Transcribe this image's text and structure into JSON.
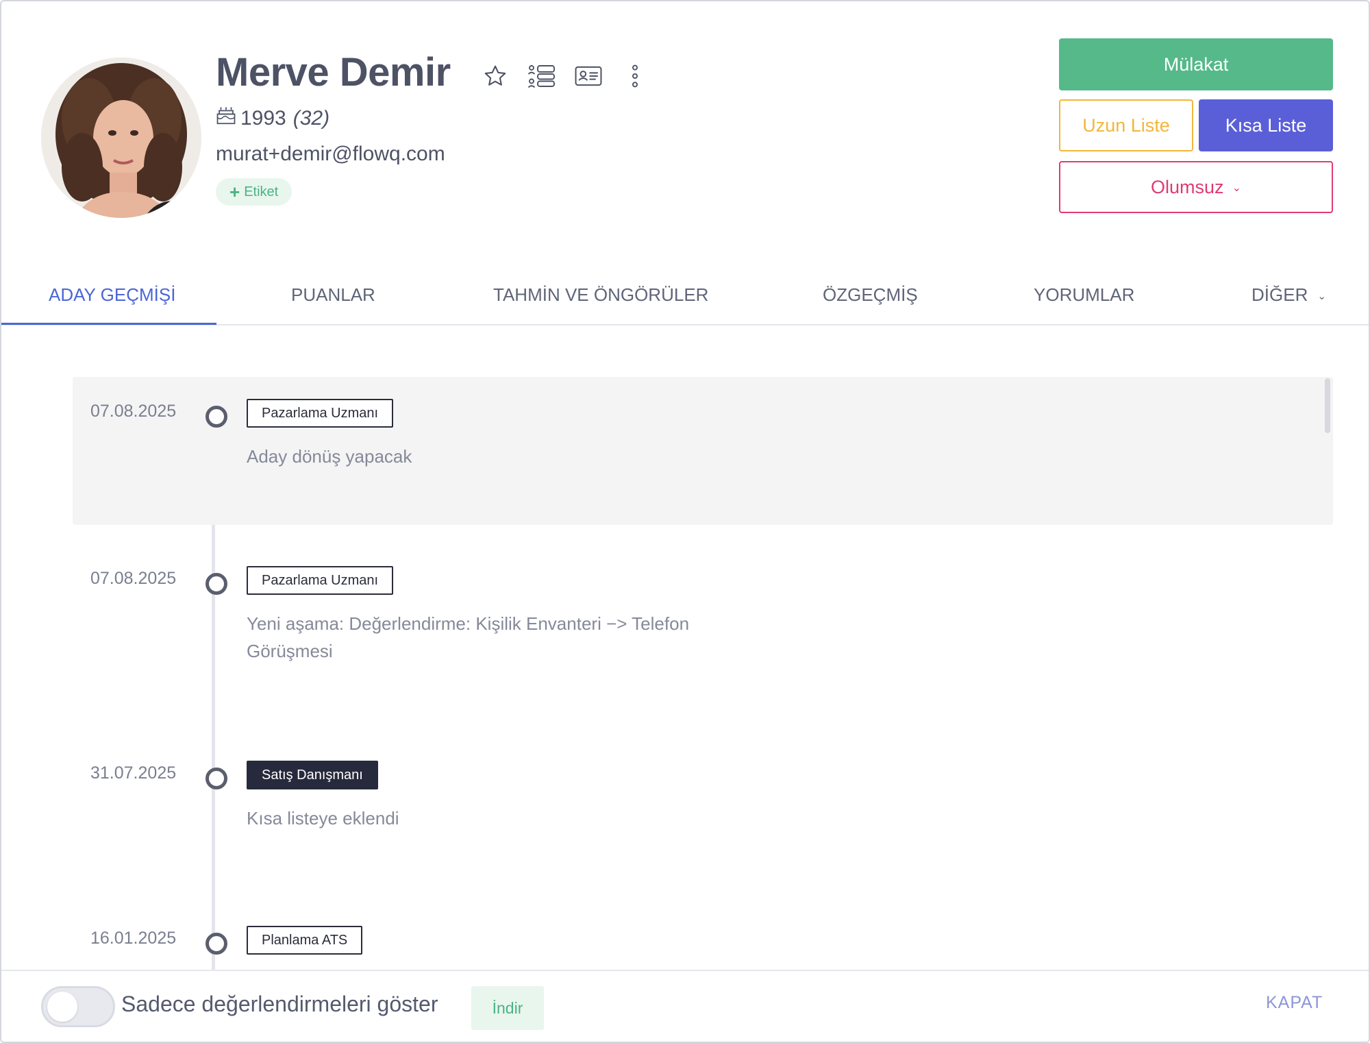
{
  "candidate": {
    "name": "Merve Demir",
    "birth_year": "1993",
    "age": "(32)",
    "email": "murat+demir@flowq.com",
    "tag_button": "Etiket"
  },
  "header_icons": [
    "star-icon",
    "pipeline-icon",
    "id-card-icon",
    "more-vertical-icon"
  ],
  "actions": {
    "interview": "Mülakat",
    "long_list": "Uzun Liste",
    "short_list": "Kısa Liste",
    "reject": "Olumsuz"
  },
  "tabs": [
    {
      "label": "ADAY GEÇMİŞİ",
      "active": true
    },
    {
      "label": "PUANLAR"
    },
    {
      "label": "TAHMİN VE ÖNGÖRÜLER"
    },
    {
      "label": "ÖZGEÇMİŞ"
    },
    {
      "label": "YORUMLAR"
    },
    {
      "label": "DİĞER"
    }
  ],
  "timeline": [
    {
      "date": "07.08.2025",
      "badge": "Pazarlama Uzmanı",
      "description": "Aday dönüş yapacak"
    },
    {
      "date": "07.08.2025",
      "badge": "Pazarlama Uzmanı",
      "description": "Yeni aşama: Değerlendirme: Kişilik Envanteri −> Telefon Görüşmesi"
    },
    {
      "date": "31.07.2025",
      "badge": "Satış Danışmanı",
      "description": "Kısa listeye eklendi"
    },
    {
      "date": "16.01.2025",
      "badge": "Planlama ATS",
      "description": ""
    }
  ],
  "footer": {
    "toggle_label": "Sadece değerlendirmeleri göster",
    "download": "İndir",
    "close": "KAPAT"
  },
  "colors": {
    "accent": "#4a66d6",
    "interview": "#55b98a",
    "long_list": "#f2b63a",
    "short_list": "#5a5fd8",
    "reject": "#e03a72"
  }
}
